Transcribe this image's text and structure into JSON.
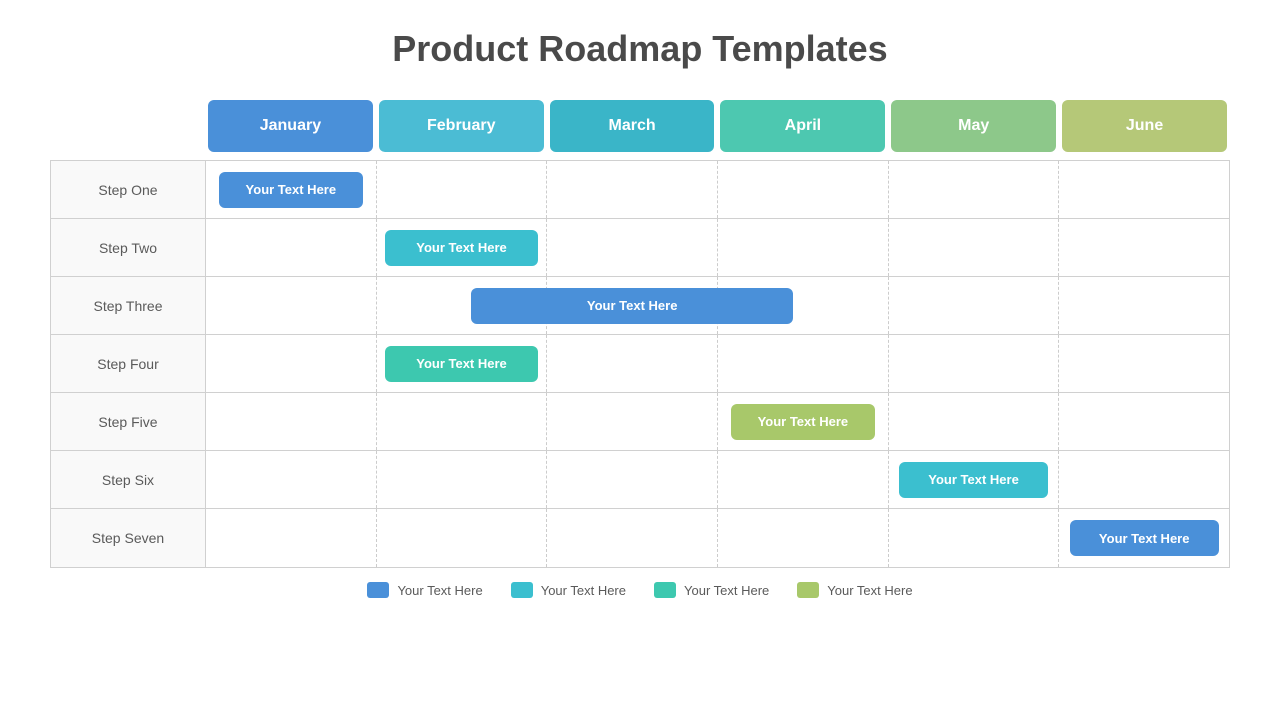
{
  "title": "Product Roadmap Templates",
  "months": [
    {
      "label": "January",
      "class": "month-january"
    },
    {
      "label": "February",
      "class": "month-february"
    },
    {
      "label": "March",
      "class": "month-march"
    },
    {
      "label": "April",
      "class": "month-april"
    },
    {
      "label": "May",
      "class": "month-may"
    },
    {
      "label": "June",
      "class": "month-june"
    }
  ],
  "rows": [
    {
      "step": "Step One",
      "bar": {
        "text": "Your Text Here",
        "col": 0,
        "span": 1,
        "colorClass": "bar-blue",
        "width": "85%"
      }
    },
    {
      "step": "Step Two",
      "bar": {
        "text": "Your Text Here",
        "col": 1,
        "span": 1,
        "colorClass": "bar-cyan",
        "width": "90%"
      }
    },
    {
      "step": "Step Three",
      "bar": {
        "text": "Your Text Here",
        "col": 2,
        "span": 2,
        "colorClass": "bar-blue",
        "width": "180%"
      }
    },
    {
      "step": "Step Four",
      "bar": {
        "text": "Your Text Here",
        "col": 1,
        "span": 1,
        "colorClass": "bar-teal",
        "width": "90%"
      }
    },
    {
      "step": "Step Five",
      "bar": {
        "text": "Your Text Here",
        "col": 3,
        "span": 1,
        "colorClass": "bar-lightgreen",
        "width": "85%"
      }
    },
    {
      "step": "Step Six",
      "bar": {
        "text": "Your Text Here",
        "col": 4,
        "span": 1,
        "colorClass": "bar-cyan",
        "width": "88%"
      }
    },
    {
      "step": "Step Seven",
      "bar": {
        "text": "Your Text Here",
        "col": 5,
        "span": 1,
        "colorClass": "bar-steelblue",
        "width": "88%"
      }
    }
  ],
  "legend": [
    {
      "color": "#4a90d9",
      "text": "Your Text Here"
    },
    {
      "color": "#3bbfcf",
      "text": "Your Text Here"
    },
    {
      "color": "#3dc8af",
      "text": "Your Text Here"
    },
    {
      "color": "#a8c86a",
      "text": "Your Text Here"
    }
  ]
}
